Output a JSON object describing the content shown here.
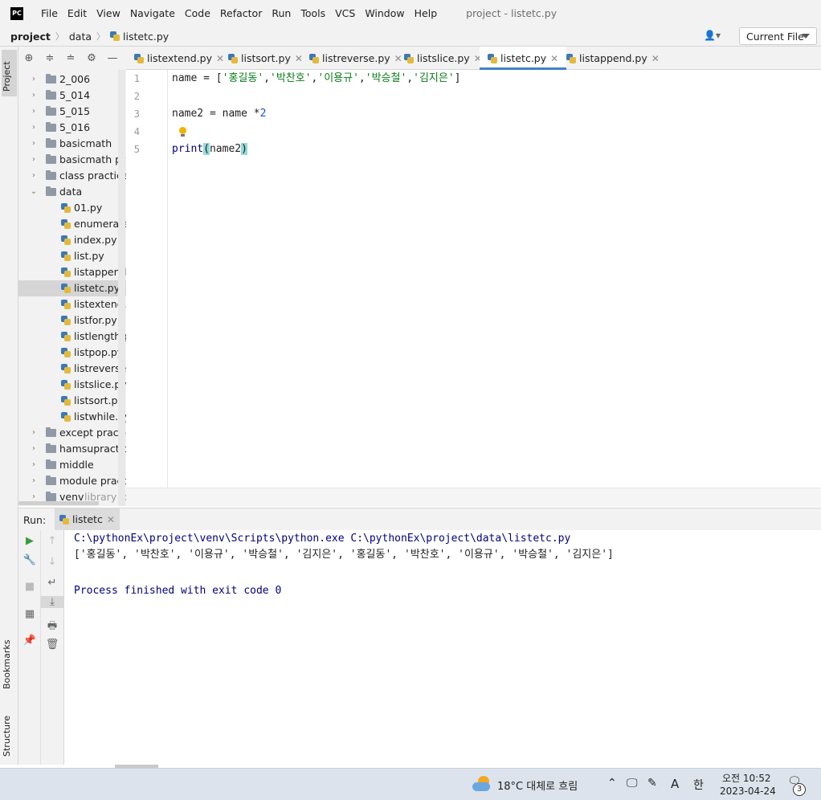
{
  "app": {
    "logo": "PC",
    "title": "project - listetc.py"
  },
  "menu": [
    "File",
    "Edit",
    "View",
    "Navigate",
    "Code",
    "Refactor",
    "Run",
    "Tools",
    "VCS",
    "Window",
    "Help"
  ],
  "breadcrumb": {
    "project": "project",
    "folder": "data",
    "file": "listetc.py"
  },
  "run_config": {
    "label": "Current File"
  },
  "side_tabs": {
    "project": "Project",
    "bookmarks": "Bookmarks",
    "structure": "Structure"
  },
  "project_tree": [
    {
      "label": "2_006",
      "type": "folder",
      "expanded": false
    },
    {
      "label": "5_014",
      "type": "folder",
      "expanded": false
    },
    {
      "label": "5_015",
      "type": "folder",
      "expanded": false
    },
    {
      "label": "5_016",
      "type": "folder",
      "expanded": false
    },
    {
      "label": "basicmath",
      "type": "folder",
      "expanded": false
    },
    {
      "label": "basicmath prac",
      "type": "folder",
      "expanded": false
    },
    {
      "label": "class practice",
      "type": "folder",
      "expanded": false
    },
    {
      "label": "data",
      "type": "folder",
      "expanded": true
    },
    {
      "label": "01.py",
      "type": "file"
    },
    {
      "label": "enumerate.p",
      "type": "file"
    },
    {
      "label": "index.py",
      "type": "file"
    },
    {
      "label": "list.py",
      "type": "file"
    },
    {
      "label": "listappend.p",
      "type": "file"
    },
    {
      "label": "listetc.py",
      "type": "file",
      "selected": true
    },
    {
      "label": "listextend.py",
      "type": "file"
    },
    {
      "label": "listfor.py",
      "type": "file"
    },
    {
      "label": "listlength.py",
      "type": "file"
    },
    {
      "label": "listpop.py",
      "type": "file"
    },
    {
      "label": "listreverse.py",
      "type": "file"
    },
    {
      "label": "listslice.py",
      "type": "file"
    },
    {
      "label": "listsort.py",
      "type": "file"
    },
    {
      "label": "listwhile.py",
      "type": "file"
    },
    {
      "label": "except practice",
      "type": "folder",
      "expanded": false
    },
    {
      "label": "hamsupractice",
      "type": "folder",
      "expanded": false
    },
    {
      "label": "middle",
      "type": "folder",
      "expanded": false
    },
    {
      "label": "module practic",
      "type": "folder",
      "expanded": false
    },
    {
      "label": "venv",
      "type": "folder",
      "expanded": false,
      "hint": "library roo"
    }
  ],
  "tabs": [
    {
      "label": "listextend.py",
      "active": false
    },
    {
      "label": "listsort.py",
      "active": false
    },
    {
      "label": "listreverse.py",
      "active": false
    },
    {
      "label": "listslice.py",
      "active": false
    },
    {
      "label": "listetc.py",
      "active": true
    },
    {
      "label": "listappend.py",
      "active": false
    }
  ],
  "editor": {
    "line_numbers": [
      "1",
      "2",
      "3",
      "4",
      "5"
    ],
    "line1": {
      "a": "name = [",
      "s1": "'홍길동'",
      "s2": "'박찬호'",
      "s3": "'이용규'",
      "s4": "'박승철'",
      "s5": "'김지은'",
      "comma": ",",
      "end": "]"
    },
    "line3": {
      "a": "name2 = name *",
      "num": "2"
    },
    "line5": {
      "fn": "print",
      "open": "(",
      "arg": "name2",
      "close": ")"
    }
  },
  "run_panel": {
    "label": "Run:",
    "tab": "listetc",
    "console": [
      "C:\\pythonEx\\project\\venv\\Scripts\\python.exe C:\\pythonEx\\project\\data\\listetc.py",
      "['홍길동', '박찬호', '이용규', '박승철', '김지은', '홍길동', '박찬호', '이용규', '박승철', '김지은']",
      "",
      "Process finished with exit code 0"
    ]
  },
  "taskbar": {
    "weather": "18°C  대체로 흐림",
    "ime": "A",
    "lang": "한",
    "time": "오전 10:52",
    "date": "2023-04-24",
    "notifications": "3"
  }
}
